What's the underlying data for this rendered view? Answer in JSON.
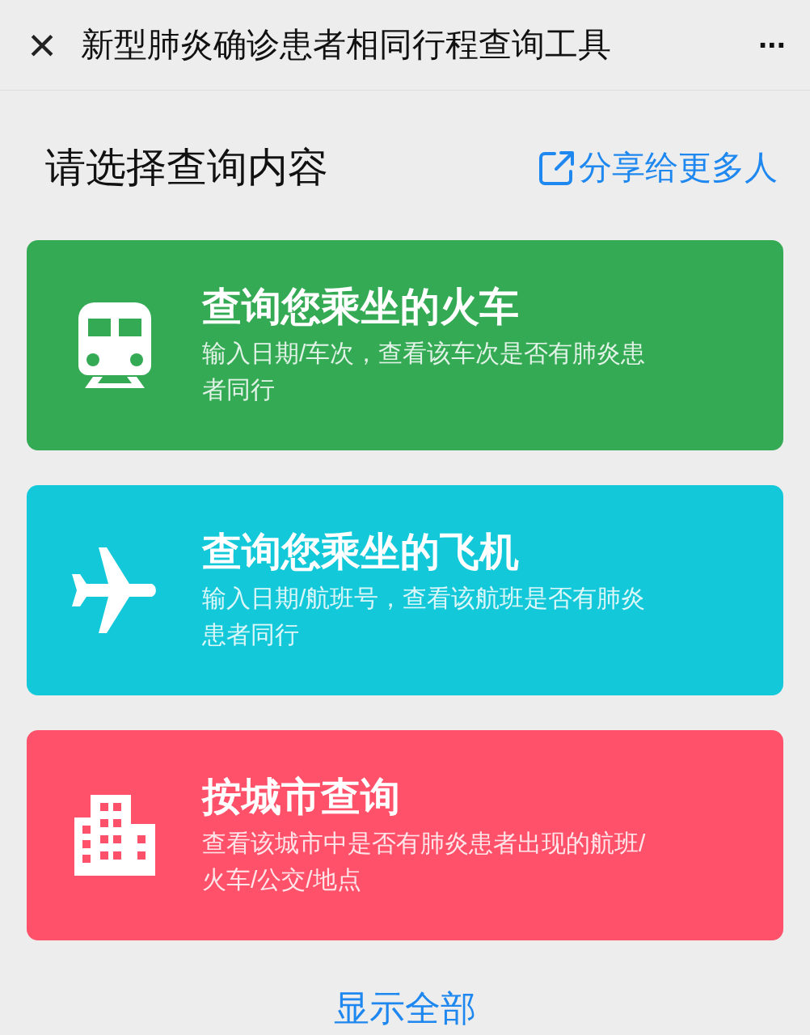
{
  "nav_bar": {
    "close": "×",
    "title": "新型肺炎确诊患者相同行程查询工具",
    "more": "···"
  },
  "header": {
    "title": "请选择查询内容",
    "share_link": "分享给更多人"
  },
  "cards": [
    {
      "kind": "train",
      "color": "#35aa55",
      "title": "查询您乘坐的火车",
      "description": "输入日期/车次，查看该车次是否有肺炎患者同行"
    },
    {
      "kind": "plane",
      "color": "#13c9d9",
      "title": "查询您乘坐的飞机",
      "description": "输入日期/航班号，查看该航班是否有肺炎患者同行"
    },
    {
      "kind": "city",
      "color": "#ff5169",
      "title": "按城市查询",
      "description": "查看该城市中是否有肺炎患者出现的航班/火车/公交/地点"
    }
  ],
  "show_all": "显示全部"
}
